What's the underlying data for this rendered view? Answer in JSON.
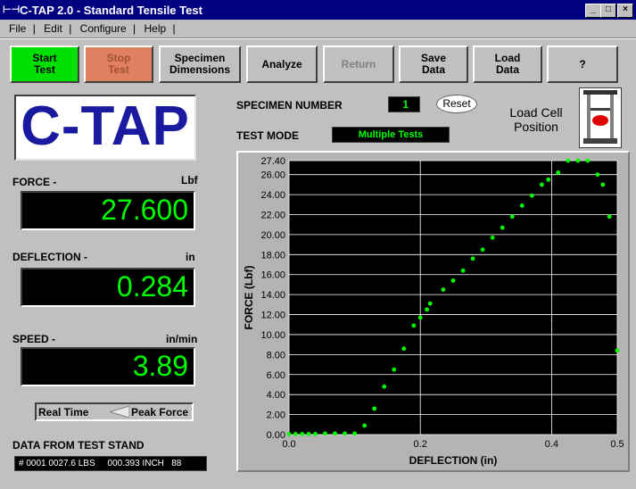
{
  "window": {
    "title": "C-TAP 2.0 - Standard Tensile Test"
  },
  "menu": [
    "File",
    "|",
    "Edit",
    "|",
    "Configure",
    "|",
    "Help",
    "|"
  ],
  "toolbar": [
    {
      "label": "Start\nTest",
      "color": "#00e000"
    },
    {
      "label": "Stop\nTest",
      "color": "#e08060"
    },
    {
      "label": "Specimen\nDimensions"
    },
    {
      "label": "Analyze"
    },
    {
      "label": "Return"
    },
    {
      "label": "Save\nData"
    },
    {
      "label": "Load\nData"
    },
    {
      "label": "?"
    }
  ],
  "logo": {
    "text": "C-TAP",
    "color": "#1a1aa0"
  },
  "specimen": {
    "label": "SPECIMEN NUMBER",
    "value": "1",
    "reset": "Reset"
  },
  "test_mode": {
    "label": "TEST MODE",
    "value": "Multiple Tests"
  },
  "load_cell": {
    "label": "Load Cell\nPosition"
  },
  "force": {
    "label": "FORCE -",
    "unit": "Lbf",
    "value": "27.600"
  },
  "deflection": {
    "label": "DEFLECTION -",
    "unit": "in",
    "value": "0.284"
  },
  "speed": {
    "label": "SPEED -",
    "unit": "in/min",
    "value": "3.89"
  },
  "toggle": {
    "left": "Real Time",
    "right": "Peak Force"
  },
  "stand": {
    "label": "DATA FROM TEST STAND",
    "value": "# 0001 0027.6 LBS     000.393 INCH   88"
  },
  "chart_data": {
    "type": "scatter",
    "xlabel": "DEFLECTION (in)",
    "ylabel": "FORCE (Lbf)",
    "xlim": [
      0,
      0.5
    ],
    "ylim": [
      0,
      27.4
    ],
    "xticks": [
      "0.0",
      "0.2",
      "0.4",
      "0.5"
    ],
    "xtick_values": [
      0,
      0.2,
      0.4,
      0.5
    ],
    "yticks": [
      "0.00",
      "2.00",
      "4.00",
      "6.00",
      "8.00",
      "10.00",
      "12.00",
      "14.00",
      "16.00",
      "18.00",
      "20.00",
      "22.00",
      "24.00",
      "26.00",
      "27.40"
    ],
    "ytick_values": [
      0,
      2,
      4,
      6,
      8,
      10,
      12,
      14,
      16,
      18,
      20,
      22,
      24,
      26,
      27.4
    ],
    "grid": true,
    "point_color": "#00ff00",
    "points": [
      [
        0.0,
        0.05
      ],
      [
        0.01,
        0.05
      ],
      [
        0.02,
        0.05
      ],
      [
        0.03,
        0.05
      ],
      [
        0.04,
        0.05
      ],
      [
        0.055,
        0.1
      ],
      [
        0.07,
        0.1
      ],
      [
        0.085,
        0.1
      ],
      [
        0.1,
        0.1
      ],
      [
        0.115,
        0.9
      ],
      [
        0.13,
        2.6
      ],
      [
        0.145,
        4.8
      ],
      [
        0.16,
        6.5
      ],
      [
        0.175,
        8.6
      ],
      [
        0.19,
        10.9
      ],
      [
        0.2,
        11.7
      ],
      [
        0.21,
        12.5
      ],
      [
        0.215,
        13.1
      ],
      [
        0.235,
        14.5
      ],
      [
        0.25,
        15.4
      ],
      [
        0.265,
        16.4
      ],
      [
        0.28,
        17.6
      ],
      [
        0.295,
        18.5
      ],
      [
        0.31,
        19.7
      ],
      [
        0.325,
        20.7
      ],
      [
        0.34,
        21.8
      ],
      [
        0.355,
        22.9
      ],
      [
        0.37,
        23.9
      ],
      [
        0.385,
        25.0
      ],
      [
        0.395,
        25.5
      ],
      [
        0.41,
        26.2
      ],
      [
        0.425,
        27.4
      ],
      [
        0.44,
        27.4
      ],
      [
        0.455,
        27.4
      ],
      [
        0.47,
        26.0
      ],
      [
        0.478,
        25.0
      ],
      [
        0.488,
        21.8
      ],
      [
        0.5,
        8.4
      ]
    ]
  }
}
